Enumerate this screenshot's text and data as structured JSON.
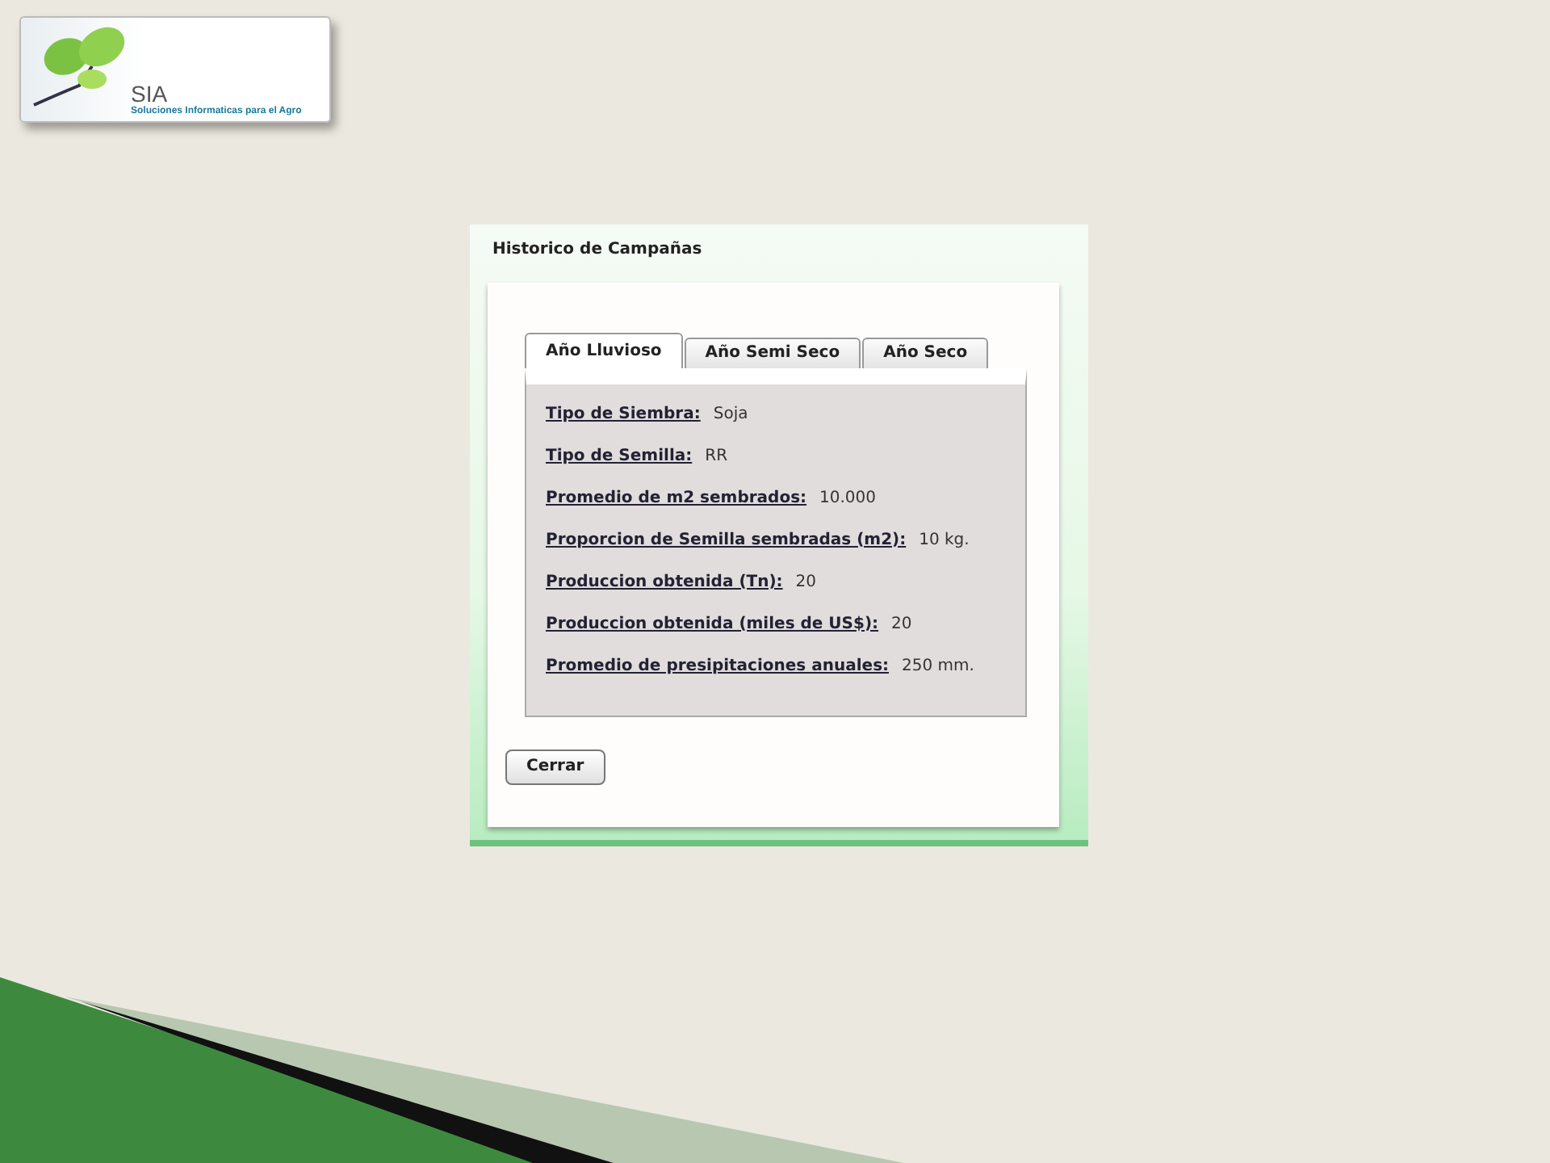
{
  "logo": {
    "title": "SIA",
    "subtitle": "Soluciones Informaticas para el Agro"
  },
  "dialog": {
    "title": "Historico de Campañas",
    "tabs": [
      {
        "label": "Año Lluvioso",
        "selected": true
      },
      {
        "label": "Año Semi Seco",
        "selected": false
      },
      {
        "label": "Año Seco",
        "selected": false
      }
    ],
    "fields": [
      {
        "label": "Tipo de Siembra:",
        "value": "Soja"
      },
      {
        "label": "Tipo de Semilla:",
        "value": "RR"
      },
      {
        "label": "Promedio de m2 sembrados:",
        "value": "10.000"
      },
      {
        "label": "Proporcion de Semilla sembradas (m2):",
        "value": "10 kg."
      },
      {
        "label": "Produccion obtenida (Tn):",
        "value": "20"
      },
      {
        "label": "Produccion obtenida (miles de US$):",
        "value": "20"
      },
      {
        "label": "Promedio de presipitaciones anuales:",
        "value": "250 mm."
      }
    ],
    "buttons": [
      "Cerrar"
    ]
  }
}
